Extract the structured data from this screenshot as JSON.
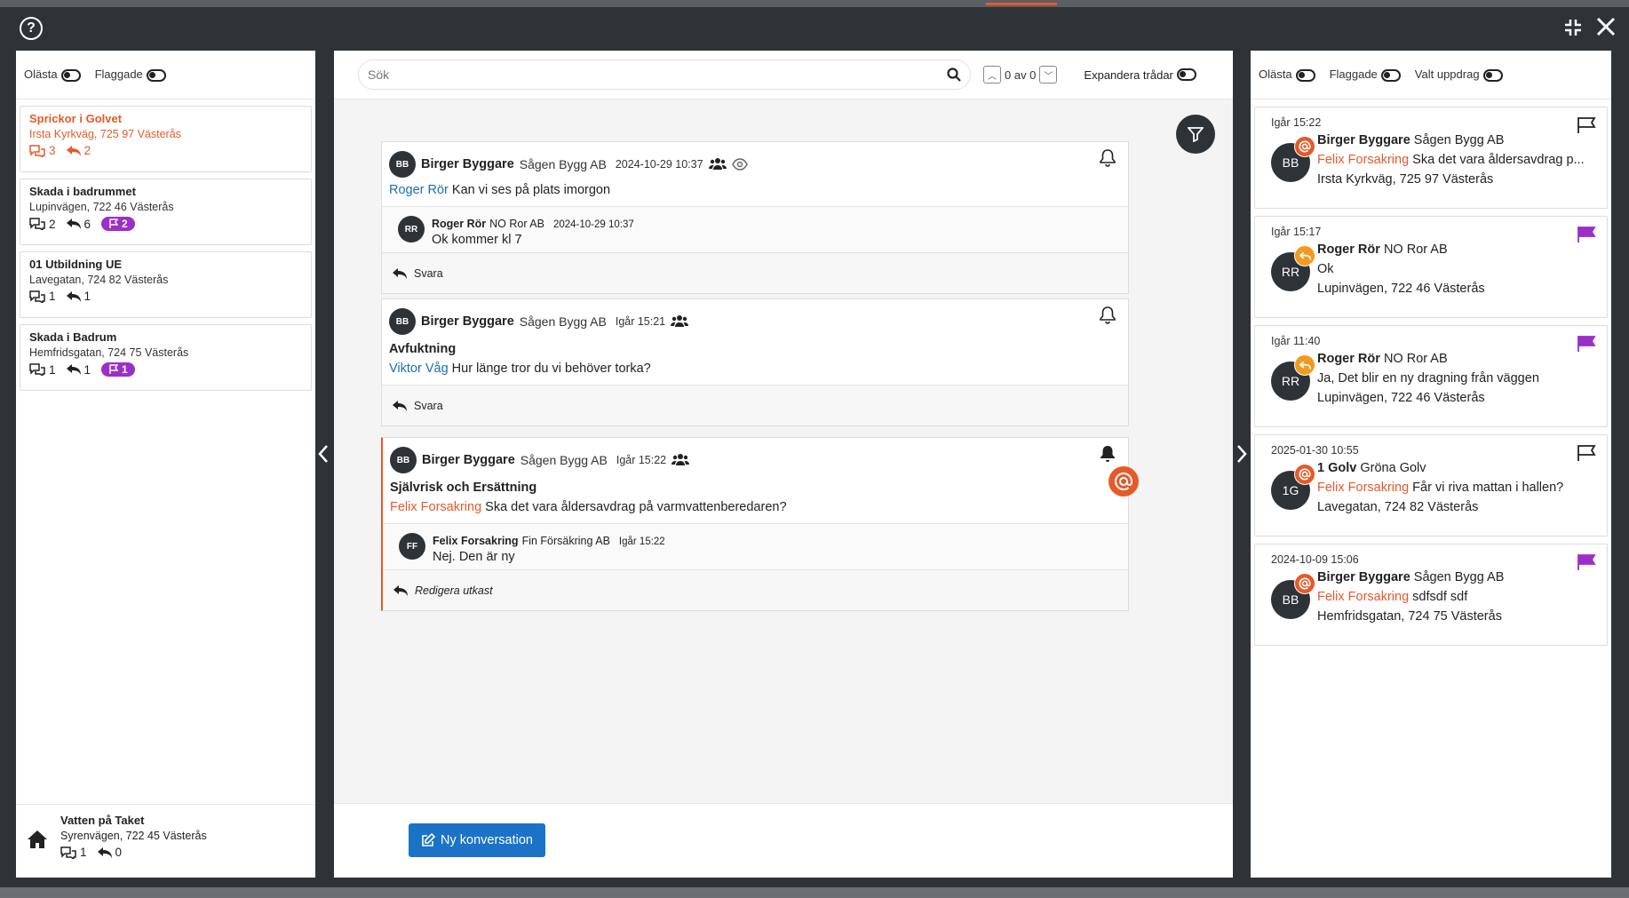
{
  "filters": {
    "unread": "Olästa",
    "flagged": "Flaggade",
    "selected_job": "Valt uppdrag"
  },
  "left_list": [
    {
      "title": "Sprickor i Golvet",
      "address": "Irsta Kyrkväg, 725 97 Västerås",
      "comments": "3",
      "replies": "2",
      "flags": ""
    },
    {
      "title": "Skada i badrummet",
      "address": "Lupinvägen, 722 46 Västerås",
      "comments": "2",
      "replies": "6",
      "flags": "2"
    },
    {
      "title": "01 Utbildning UE",
      "address": "Lavegatan, 724 82 Västerås",
      "comments": "1",
      "replies": "1",
      "flags": ""
    },
    {
      "title": "Skada i Badrum",
      "address": "Hemfridsgatan, 724 75 Västerås",
      "comments": "1",
      "replies": "1",
      "flags": "1"
    }
  ],
  "left_footer": {
    "title": "Vatten på Taket",
    "address": "Syrenvägen, 722 45 Västerås",
    "comments": "1",
    "replies": "0"
  },
  "search": {
    "placeholder": "Sök",
    "counter": "0 av 0",
    "expand_label": "Expandera trådar"
  },
  "messages": [
    {
      "initials": "BB",
      "name": "Birger Byggare",
      "company": "Sågen Bygg AB",
      "date": "2024-10-29 10:37",
      "mention": "Roger Rör",
      "text": "Kan vi ses på plats imorgon",
      "reply": {
        "initials": "RR",
        "name": "Roger Rör",
        "company": "NO Ror AB",
        "date": "2024-10-29 10:37",
        "text": "Ok kommer kl 7"
      },
      "action": "Svara"
    },
    {
      "initials": "BB",
      "name": "Birger Byggare",
      "company": "Sågen Bygg AB",
      "date": "Igår 15:21",
      "title": "Avfuktning",
      "mention": "Viktor Våg",
      "text": "Hur länge tror du vi behöver torka?",
      "action": "Svara"
    },
    {
      "initials": "BB",
      "name": "Birger Byggare",
      "company": "Sågen Bygg AB",
      "date": "Igår 15:22",
      "title": "Självrisk och Ersättning",
      "mention": "Felix Forsakring",
      "text": "Ska det vara åldersavdrag på varmvattenberedaren?",
      "reply": {
        "initials": "FF",
        "name": "Felix Forsakring",
        "company": "Fin Försäkring AB",
        "date": "Igår 15:22",
        "text": "Nej. Den är ny"
      },
      "action": "Redigera utkast"
    }
  ],
  "new_conversation": "Ny konversation",
  "right_list": [
    {
      "date": "Igår 15:22",
      "initials": "BB",
      "name": "Birger Byggare",
      "company": "Sågen Bygg AB",
      "mention": "Felix Forsakring",
      "text": "Ska det vara åldersavdrag p...",
      "address": "Irsta Kyrkväg, 725 97 Västerås",
      "badge": "at",
      "flag": "outline"
    },
    {
      "date": "Igår 15:17",
      "initials": "RR",
      "name": "Roger Rör",
      "company": "NO Ror AB",
      "mention": "",
      "text": "Ok",
      "address": "Lupinvägen, 722 46 Västerås",
      "badge": "reply",
      "flag": "filled"
    },
    {
      "date": "Igår 11:40",
      "initials": "RR",
      "name": "Roger Rör",
      "company": "NO Ror AB",
      "mention": "",
      "text": "Ja, Det blir en ny dragning från väggen",
      "address": "Lupinvägen, 722 46 Västerås",
      "badge": "reply",
      "flag": "filled"
    },
    {
      "date": "2025-01-30 10:55",
      "initials": "1G",
      "name": "1 Golv",
      "company": "Gröna Golv",
      "mention": "Felix Forsakring",
      "text": "Får vi riva mattan i hallen?",
      "address": "Lavegatan, 724 82 Västerås",
      "badge": "at",
      "flag": "outline"
    },
    {
      "date": "2024-10-09 15:06",
      "initials": "BB",
      "name": "Birger Byggare",
      "company": "Sågen Bygg AB",
      "mention": "Felix Forsakring",
      "text": "sdfsdf sdf",
      "address": "Hemfridsgatan, 724 75 Västerås",
      "badge": "at",
      "flag": "filled"
    }
  ],
  "colors": {
    "accent": "#e55a2b",
    "flag": "#9b2fc8",
    "primary": "#1a73c6",
    "dark": "#2e3338"
  }
}
